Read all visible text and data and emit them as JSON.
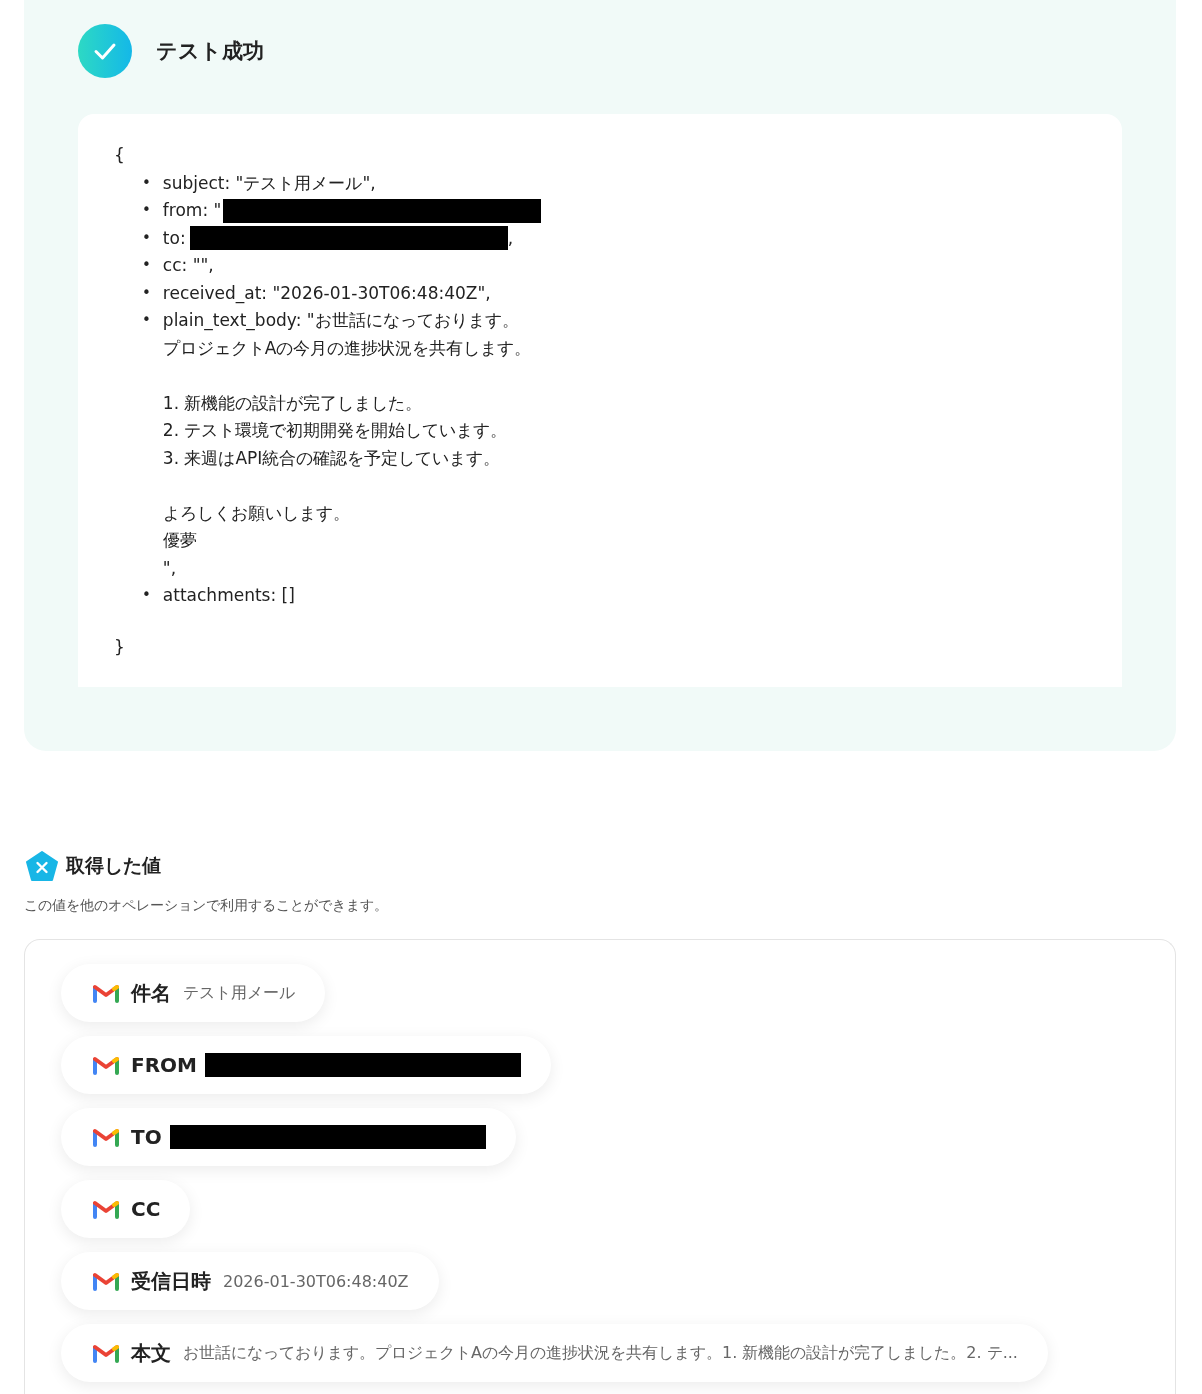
{
  "result": {
    "title": "テスト成功",
    "open_brace": "{",
    "close_brace": "}",
    "fields": [
      {
        "bullet": "•",
        "paragraphs": [
          [
            "subject: \"テスト用メール\","
          ]
        ],
        "redacted": false
      },
      {
        "bullet": "•",
        "paragraphs": [
          [
            "from: \""
          ]
        ],
        "redacted": true
      },
      {
        "bullet": "•",
        "paragraphs": [
          [
            "to:"
          ]
        ],
        "redacted": true,
        "suffix": ","
      },
      {
        "bullet": "•",
        "paragraphs": [
          [
            "cc: \"\","
          ]
        ],
        "redacted": false
      },
      {
        "bullet": "•",
        "paragraphs": [
          [
            "received_at: \"2026-01-30T06:48:40Z\","
          ]
        ],
        "redacted": false
      },
      {
        "bullet": "•",
        "paragraphs": [
          [
            "plain_text_body: \"お世話になっております。",
            "プロジェクトAの今月の進捗状況を共有します。"
          ],
          [
            "1. 新機能の設計が完了しました。",
            "2. テスト環境で初期開発を開始しています。",
            "3. 来週はAPI統合の確認を予定しています。"
          ],
          [
            "よろしくお願いします。",
            "優夢",
            "\","
          ]
        ],
        "redacted": false
      },
      {
        "bullet": "•",
        "paragraphs": [
          [
            "attachments: []"
          ]
        ],
        "redacted": false
      }
    ]
  },
  "values": {
    "title": "取得した値",
    "description": "この値を他のオペレーションで利用することができます。",
    "items": [
      {
        "label": "件名",
        "value": "テスト用メール",
        "redacted": false
      },
      {
        "label": "FROM",
        "redacted": true
      },
      {
        "label": "TO",
        "redacted": true
      },
      {
        "label": "CC",
        "redacted": false
      },
      {
        "label": "受信日時",
        "value": "2026-01-30T06:48:40Z",
        "redacted": false
      },
      {
        "label": "本文",
        "value": "お世話になっております。プロジェクトAの今月の進捗状況を共有します。1. 新機能の設計が完了しました。2. テ...",
        "redacted": false
      }
    ]
  }
}
